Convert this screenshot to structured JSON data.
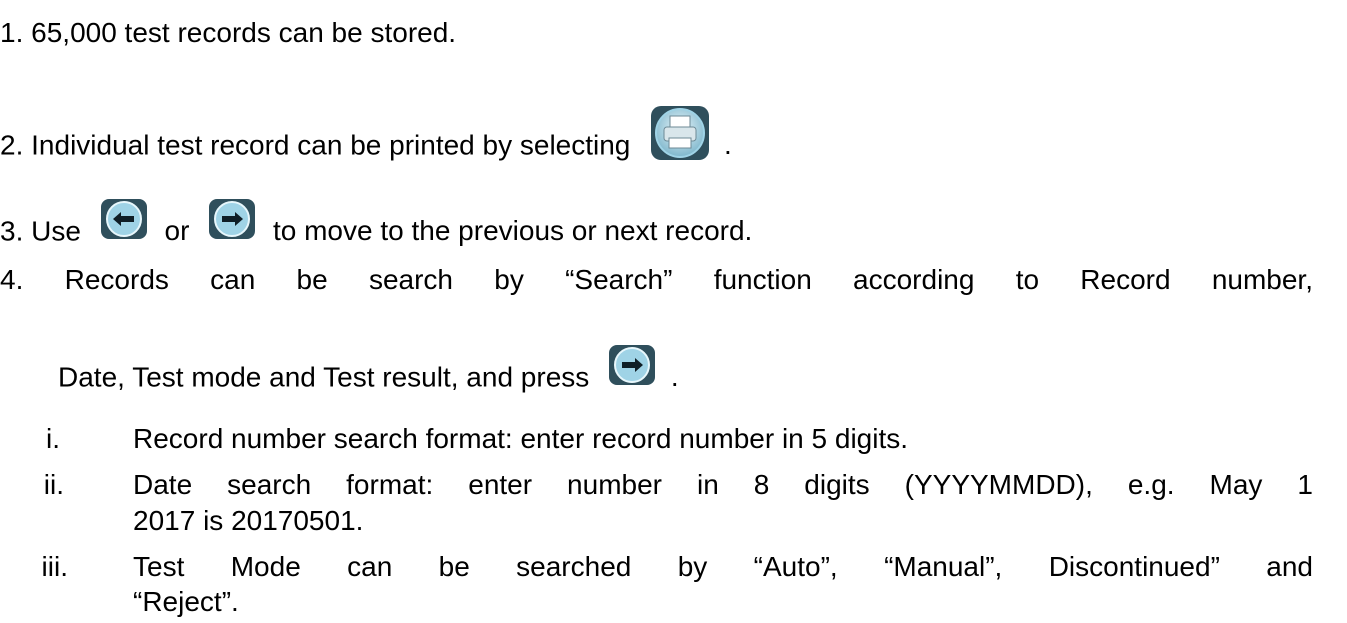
{
  "items": {
    "item1": {
      "num": "1.",
      "text": "65,000 test records can be stored."
    },
    "item2": {
      "num": "2.",
      "text_before": "Individual test record can be printed by selecting",
      "text_after": ".",
      "icon": "printer-icon"
    },
    "item3": {
      "num": "3.",
      "text_use": "Use",
      "text_or": "or",
      "text_after": "to move to the previous or next record.",
      "icon_prev": "arrow-left-icon",
      "icon_next": "arrow-right-icon"
    },
    "item4": {
      "num": "4.",
      "text_line1": "Records can be search by “Search” function according to Record number,",
      "text_line2_before": "Date, Test mode and Test result, and press",
      "text_line2_after": ".",
      "icon": "arrow-right-icon"
    }
  },
  "subitems": [
    {
      "num": "i.",
      "lines": [
        "Record number search format: enter record number in 5 digits."
      ]
    },
    {
      "num": "ii.",
      "lines": [
        "Date search format: enter number in 8 digits (YYYYMMDD), e.g. May 1",
        "2017 is 20170501."
      ]
    },
    {
      "num": "iii.",
      "lines": [
        "Test Mode can be searched by “Auto”, “Manual”, Discontinued” and",
        "“Reject”."
      ]
    }
  ],
  "colors": {
    "text": "#000000",
    "icon_bg": "#2f4f5c",
    "icon_ring": "#9fd3e6",
    "icon_arrow": "#0f1e26"
  }
}
